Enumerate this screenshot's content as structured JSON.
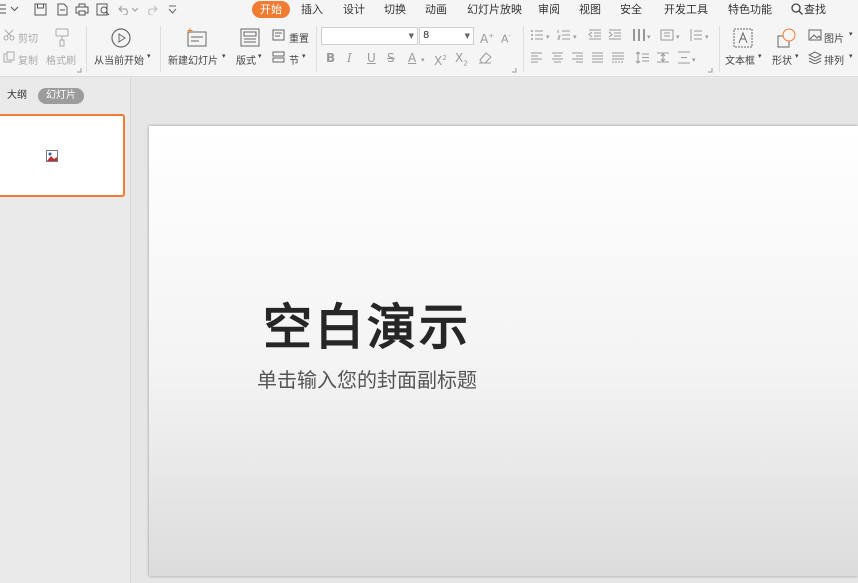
{
  "menu": {
    "tabs": [
      "开始",
      "插入",
      "设计",
      "切换",
      "动画",
      "幻灯片放映",
      "审阅",
      "视图",
      "安全",
      "开发工具",
      "特色功能"
    ],
    "search_label": "查找"
  },
  "ribbon": {
    "cut": "剪切",
    "copy": "复制",
    "format_painter": "格式刷",
    "play_from_current": "从当前开始",
    "new_slide": "新建幻灯片",
    "layout": "版式",
    "reset": "重置",
    "section": "节",
    "font_name": "",
    "font_size": "8",
    "textbox": "文本框",
    "shape": "形状",
    "picture": "图片",
    "arrange": "排列"
  },
  "left_panel": {
    "tab_outline": "大纲",
    "tab_slides": "幻灯片"
  },
  "slide": {
    "title": "空白演示",
    "subtitle": "单击输入您的封面副标题"
  },
  "colors": {
    "accent": "#f07c32",
    "ribbon_bg": "#f5f5f5",
    "canvas_bg": "#e6e6e6"
  }
}
